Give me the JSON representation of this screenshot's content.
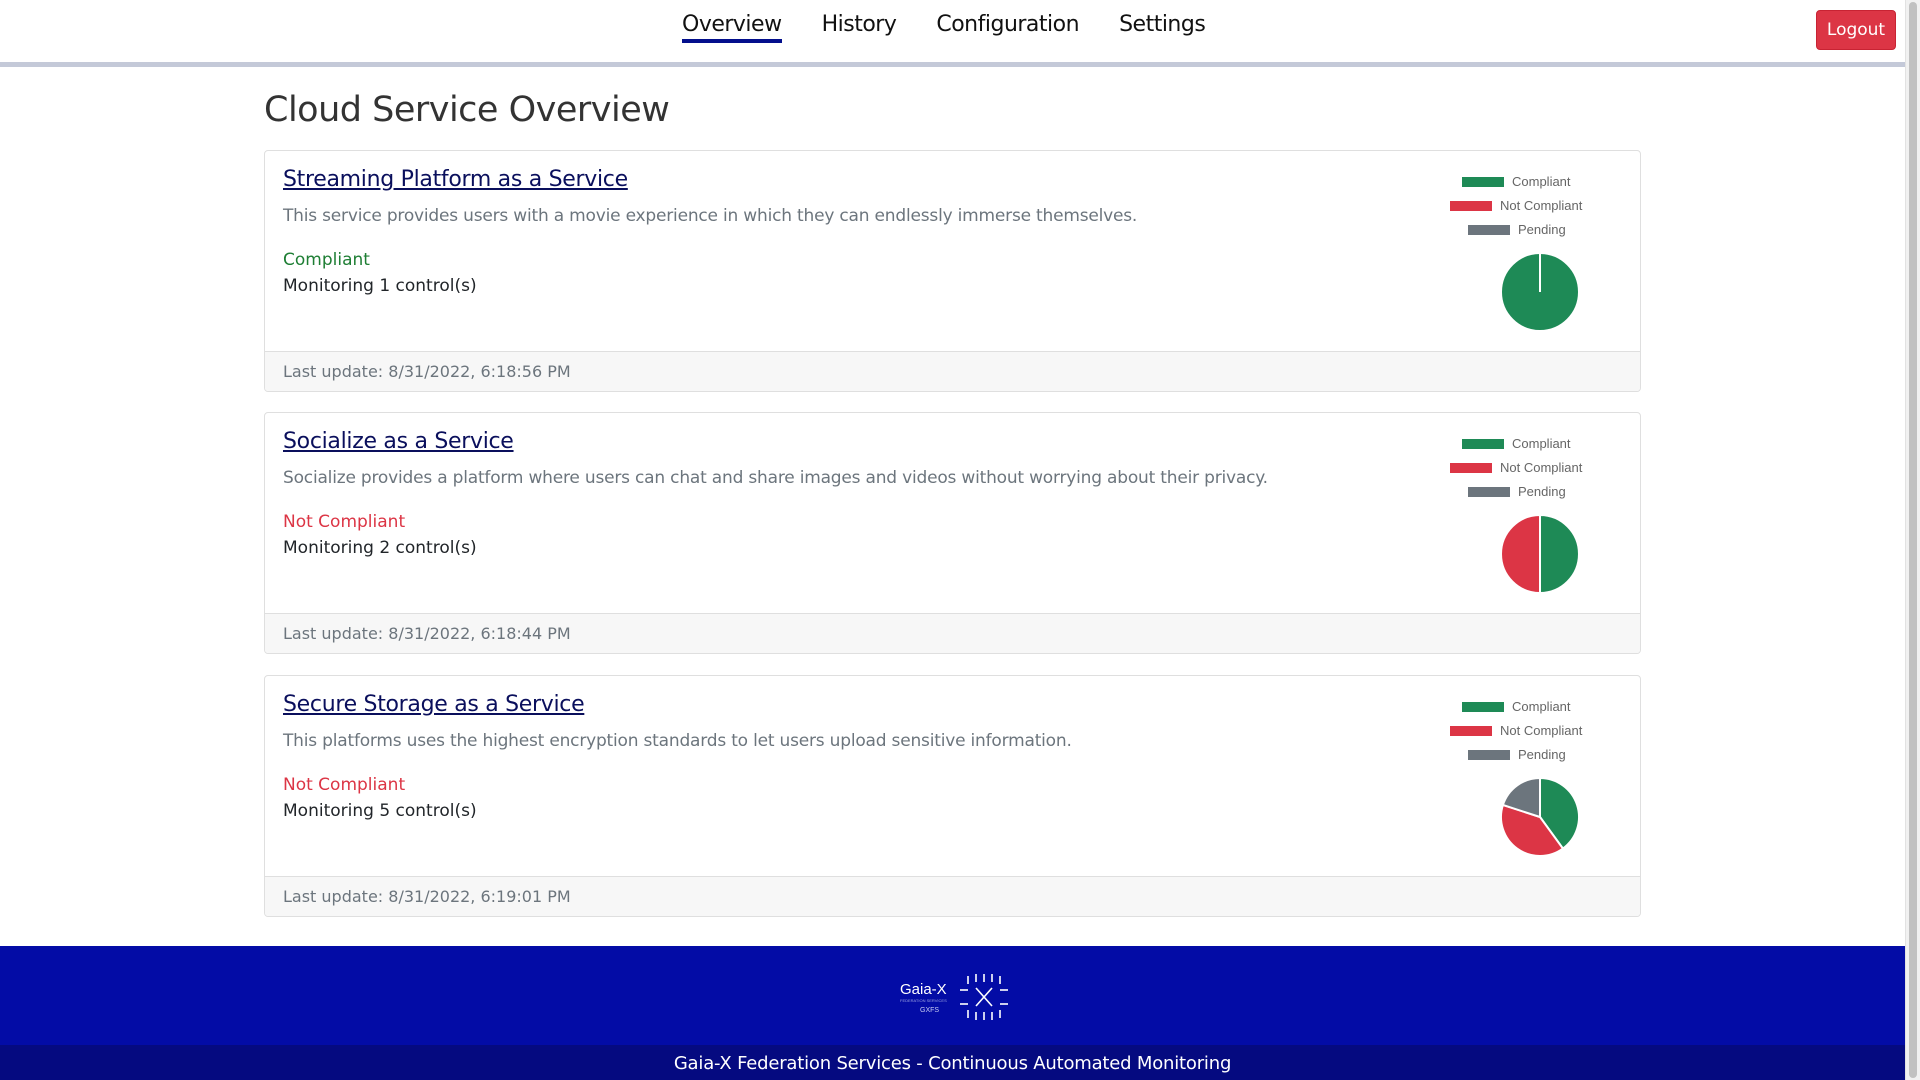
{
  "nav": {
    "links": [
      "Overview",
      "History",
      "Configuration",
      "Settings"
    ],
    "active": "Overview",
    "logout_label": "Logout"
  },
  "page": {
    "title": "Cloud Service Overview"
  },
  "legend": {
    "compliant": "Compliant",
    "not_compliant": "Not Compliant",
    "pending": "Pending"
  },
  "colors": {
    "compliant": "#1e8a56",
    "not_compliant": "#dc3545",
    "pending": "#6c757d",
    "brand": "#030f8c"
  },
  "services": [
    {
      "title": "Streaming Platform as a Service",
      "description": "This service provides users with a movie experience in which they can endlessly immerse themselves.",
      "status": "Compliant",
      "monitoring": "Monitoring 1 control(s)",
      "updated": "Last update: 8/31/2022, 6:18:56 PM"
    },
    {
      "title": "Socialize as a Service",
      "description": "Socialize provides a platform where users can chat and share images and videos without worrying about their privacy.",
      "status": "Not Compliant",
      "monitoring": "Monitoring 2 control(s)",
      "updated": "Last update: 8/31/2022, 6:18:44 PM"
    },
    {
      "title": "Secure Storage as a Service",
      "description": "This platforms uses the highest encryption standards to let users upload sensitive information.",
      "status": "Not Compliant",
      "monitoring": "Monitoring 5 control(s)",
      "updated": "Last update: 8/31/2022, 6:19:01 PM"
    }
  ],
  "chart_data": [
    {
      "type": "pie",
      "categories": [
        "Compliant",
        "Not Compliant",
        "Pending"
      ],
      "values": [
        1,
        0,
        0
      ]
    },
    {
      "type": "pie",
      "categories": [
        "Compliant",
        "Not Compliant",
        "Pending"
      ],
      "values": [
        1,
        1,
        0
      ]
    },
    {
      "type": "pie",
      "categories": [
        "Compliant",
        "Not Compliant",
        "Pending"
      ],
      "values": [
        2,
        2,
        1
      ]
    }
  ],
  "footer": {
    "logo_text": "Gaia-X",
    "logo_sub": "GXFS",
    "text": "Gaia-X Federation Services - Continuous Automated Monitoring"
  }
}
